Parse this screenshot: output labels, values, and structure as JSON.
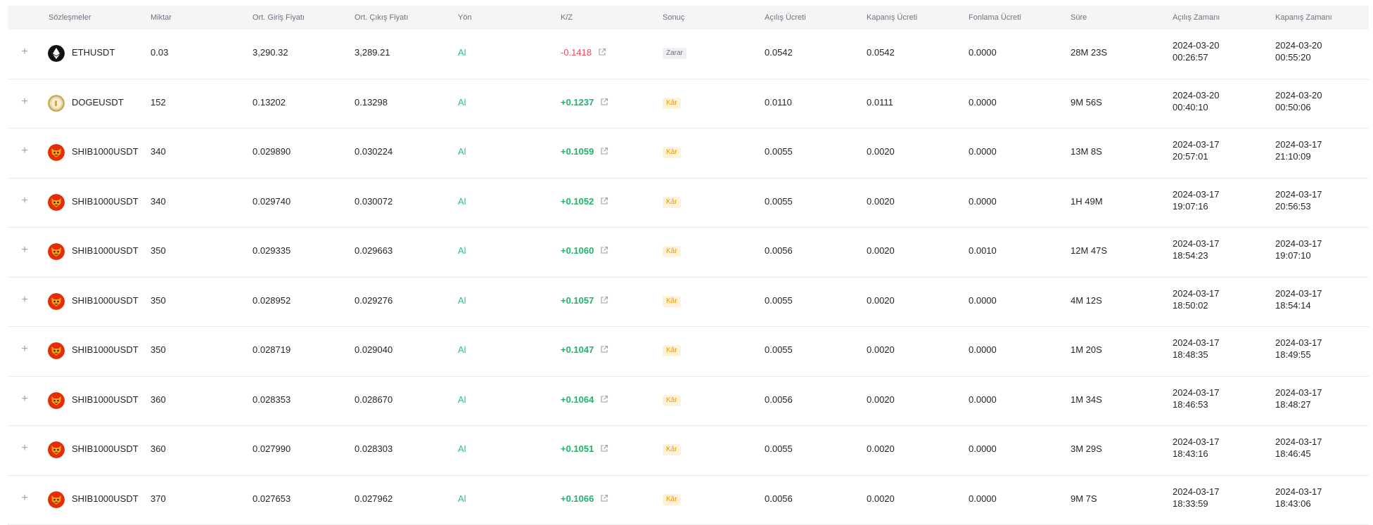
{
  "headers": [
    "Sözleşmeler",
    "Miktar",
    "Ort. Giriş Fiyatı",
    "Ort. Çıkış Fiyatı",
    "Yön",
    "K/Z",
    "Sonuç",
    "Açılış Ücreti",
    "Kapanış Ücreti",
    "Fonlama Ücreti",
    "Süre",
    "Açılış Zamanı",
    "Kapanış Zamanı"
  ],
  "colors": {
    "positive": "#20b26c",
    "negative": "#f6465d",
    "direction": "#2ebd85",
    "win_badge_bg": "#fff1dc",
    "win_badge_text": "#e59b00",
    "loss_badge_bg": "#eef0f2"
  },
  "rows": [
    {
      "symbol": "ETHUSDT",
      "coin": "eth",
      "qty": "0.03",
      "entry": "3,290.32",
      "exit": "3,289.21",
      "dir": "Al",
      "pnl": "-0.1418",
      "pnl_sign": "neg",
      "result": "Zarar",
      "result_type": "loss",
      "open_fee": "0.0542",
      "close_fee": "0.0542",
      "funding": "0.0000",
      "duration": "28M 23S",
      "open_date": "2024-03-20",
      "open_time": "00:26:57",
      "close_date": "2024-03-20",
      "close_time": "00:55:20"
    },
    {
      "symbol": "DOGEUSDT",
      "coin": "doge",
      "qty": "152",
      "entry": "0.13202",
      "exit": "0.13298",
      "dir": "Al",
      "pnl": "+0.1237",
      "pnl_sign": "pos",
      "result": "Kâr",
      "result_type": "win",
      "open_fee": "0.0110",
      "close_fee": "0.0111",
      "funding": "0.0000",
      "duration": "9M 56S",
      "open_date": "2024-03-20",
      "open_time": "00:40:10",
      "close_date": "2024-03-20",
      "close_time": "00:50:06"
    },
    {
      "symbol": "SHIB1000USDT",
      "coin": "shib",
      "qty": "340",
      "entry": "0.029890",
      "exit": "0.030224",
      "dir": "Al",
      "pnl": "+0.1059",
      "pnl_sign": "pos",
      "result": "Kâr",
      "result_type": "win",
      "open_fee": "0.0055",
      "close_fee": "0.0020",
      "funding": "0.0000",
      "duration": "13M 8S",
      "open_date": "2024-03-17",
      "open_time": "20:57:01",
      "close_date": "2024-03-17",
      "close_time": "21:10:09"
    },
    {
      "symbol": "SHIB1000USDT",
      "coin": "shib",
      "qty": "340",
      "entry": "0.029740",
      "exit": "0.030072",
      "dir": "Al",
      "pnl": "+0.1052",
      "pnl_sign": "pos",
      "result": "Kâr",
      "result_type": "win",
      "open_fee": "0.0055",
      "close_fee": "0.0020",
      "funding": "0.0000",
      "duration": "1H 49M",
      "open_date": "2024-03-17",
      "open_time": "19:07:16",
      "close_date": "2024-03-17",
      "close_time": "20:56:53"
    },
    {
      "symbol": "SHIB1000USDT",
      "coin": "shib",
      "qty": "350",
      "entry": "0.029335",
      "exit": "0.029663",
      "dir": "Al",
      "pnl": "+0.1060",
      "pnl_sign": "pos",
      "result": "Kâr",
      "result_type": "win",
      "open_fee": "0.0056",
      "close_fee": "0.0020",
      "funding": "0.0010",
      "duration": "12M 47S",
      "open_date": "2024-03-17",
      "open_time": "18:54:23",
      "close_date": "2024-03-17",
      "close_time": "19:07:10"
    },
    {
      "symbol": "SHIB1000USDT",
      "coin": "shib",
      "qty": "350",
      "entry": "0.028952",
      "exit": "0.029276",
      "dir": "Al",
      "pnl": "+0.1057",
      "pnl_sign": "pos",
      "result": "Kâr",
      "result_type": "win",
      "open_fee": "0.0055",
      "close_fee": "0.0020",
      "funding": "0.0000",
      "duration": "4M 12S",
      "open_date": "2024-03-17",
      "open_time": "18:50:02",
      "close_date": "2024-03-17",
      "close_time": "18:54:14"
    },
    {
      "symbol": "SHIB1000USDT",
      "coin": "shib",
      "qty": "350",
      "entry": "0.028719",
      "exit": "0.029040",
      "dir": "Al",
      "pnl": "+0.1047",
      "pnl_sign": "pos",
      "result": "Kâr",
      "result_type": "win",
      "open_fee": "0.0055",
      "close_fee": "0.0020",
      "funding": "0.0000",
      "duration": "1M 20S",
      "open_date": "2024-03-17",
      "open_time": "18:48:35",
      "close_date": "2024-03-17",
      "close_time": "18:49:55"
    },
    {
      "symbol": "SHIB1000USDT",
      "coin": "shib",
      "qty": "360",
      "entry": "0.028353",
      "exit": "0.028670",
      "dir": "Al",
      "pnl": "+0.1064",
      "pnl_sign": "pos",
      "result": "Kâr",
      "result_type": "win",
      "open_fee": "0.0056",
      "close_fee": "0.0020",
      "funding": "0.0000",
      "duration": "1M 34S",
      "open_date": "2024-03-17",
      "open_time": "18:46:53",
      "close_date": "2024-03-17",
      "close_time": "18:48:27"
    },
    {
      "symbol": "SHIB1000USDT",
      "coin": "shib",
      "qty": "360",
      "entry": "0.027990",
      "exit": "0.028303",
      "dir": "Al",
      "pnl": "+0.1051",
      "pnl_sign": "pos",
      "result": "Kâr",
      "result_type": "win",
      "open_fee": "0.0055",
      "close_fee": "0.0020",
      "funding": "0.0000",
      "duration": "3M 29S",
      "open_date": "2024-03-17",
      "open_time": "18:43:16",
      "close_date": "2024-03-17",
      "close_time": "18:46:45"
    },
    {
      "symbol": "SHIB1000USDT",
      "coin": "shib",
      "qty": "370",
      "entry": "0.027653",
      "exit": "0.027962",
      "dir": "Al",
      "pnl": "+0.1066",
      "pnl_sign": "pos",
      "result": "Kâr",
      "result_type": "win",
      "open_fee": "0.0056",
      "close_fee": "0.0020",
      "funding": "0.0000",
      "duration": "9M 7S",
      "open_date": "2024-03-17",
      "open_time": "18:33:59",
      "close_date": "2024-03-17",
      "close_time": "18:43:06"
    }
  ]
}
